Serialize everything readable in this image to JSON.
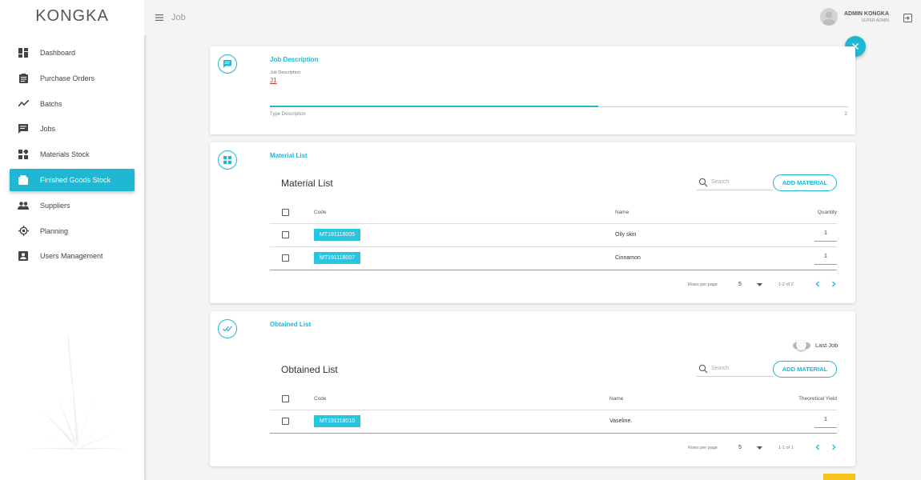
{
  "app": {
    "brand": "KONGKA"
  },
  "sidebar": {
    "items": [
      {
        "label": "Dashboard",
        "icon": "dashboard-icon"
      },
      {
        "label": "Purchase Orders",
        "icon": "clipboard-icon"
      },
      {
        "label": "Batchs",
        "icon": "trending-icon"
      },
      {
        "label": "Jobs",
        "icon": "message-icon"
      },
      {
        "label": "Materials Stock",
        "icon": "widgets-icon"
      },
      {
        "label": "Finished Goods Stock",
        "icon": "inventory-icon",
        "active": true
      },
      {
        "label": "Suppliers",
        "icon": "people-icon"
      },
      {
        "label": "Planning",
        "icon": "target-icon"
      },
      {
        "label": "Users Management",
        "icon": "account-box-icon"
      }
    ]
  },
  "header": {
    "title": "Job",
    "user_name": "ADMIN KONGKA",
    "user_role": "SUPER ADMIN"
  },
  "job_description": {
    "title": "Job Description",
    "field_label": "Job Description",
    "field_value": "J1",
    "helper": "Type Description",
    "count": "2"
  },
  "material_list": {
    "card_title": "Material List",
    "title": "Material List",
    "search_placeholder": "Search",
    "add_label": "ADD MATERIAL",
    "columns": {
      "code": "Code",
      "name": "Name",
      "qty": "Quantity"
    },
    "rows": [
      {
        "code": "MT191118005",
        "name": "Oily skin",
        "qty": "1"
      },
      {
        "code": "MT191118007",
        "name": "Cinnamon",
        "qty": "1"
      }
    ],
    "pager": {
      "rows_per_page": "Rows per page",
      "value": "5",
      "range": "1-2 of 2"
    }
  },
  "obtained_list": {
    "card_title": "Obtained List",
    "title": "Obtained List",
    "toggle_label": "Last Job",
    "search_placeholder": "Search",
    "add_label": "ADD MATERIAL",
    "columns": {
      "code": "Code",
      "name": "Name",
      "qty": "Theoretical Yield"
    },
    "rows": [
      {
        "code": "MT191118010",
        "name": "Vaseline.",
        "qty": "1"
      }
    ],
    "pager": {
      "rows_per_page": "Rows per page",
      "value": "5",
      "range": "1-1 of 1"
    }
  },
  "colors": {
    "accent": "#1fb7d1",
    "chip": "#29c4de",
    "warning": "#f6c21d"
  }
}
